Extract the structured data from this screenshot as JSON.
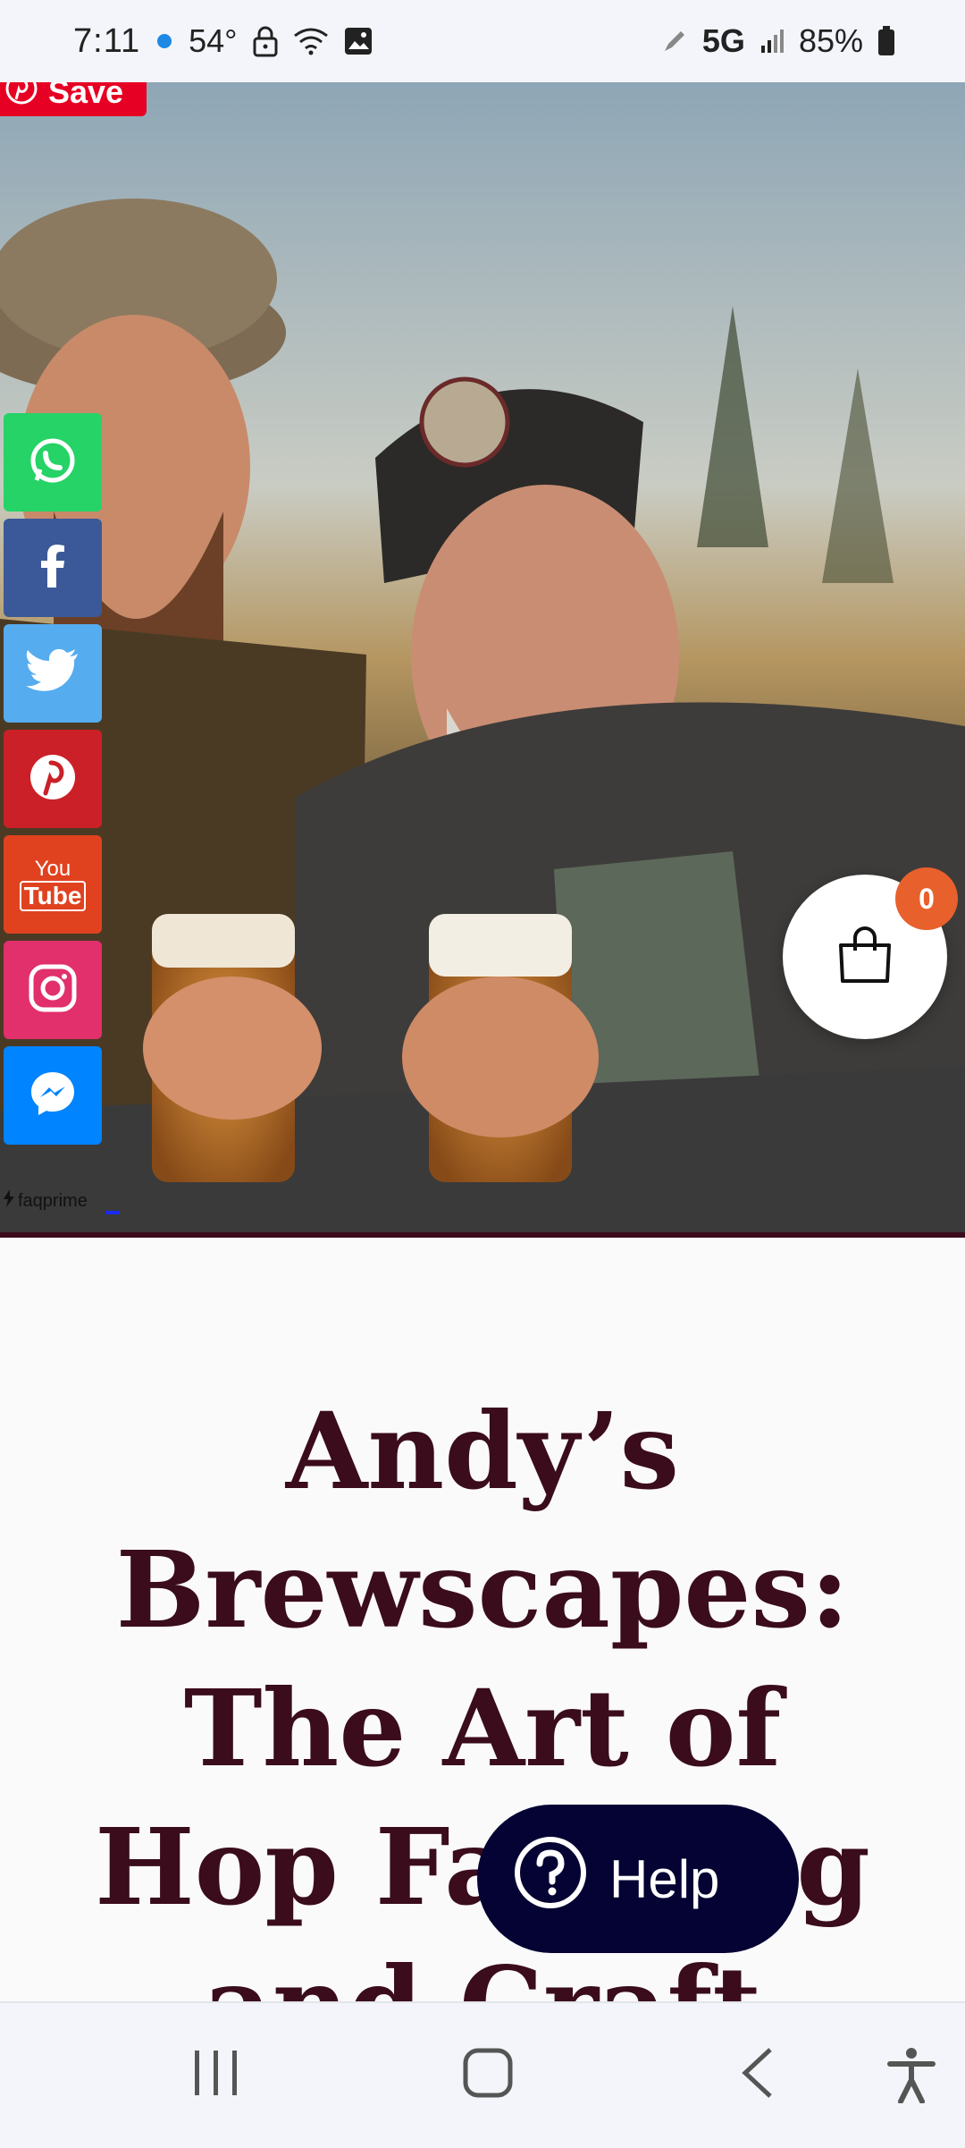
{
  "status_bar": {
    "time": "7:11",
    "temperature": "54°",
    "network": "5G",
    "battery": "85%"
  },
  "pinterest": {
    "save_label": "Save"
  },
  "social_buttons": [
    {
      "name": "whatsapp",
      "color": "#25d366"
    },
    {
      "name": "facebook",
      "color": "#3b5998"
    },
    {
      "name": "twitter",
      "color": "#55acee"
    },
    {
      "name": "pinterest",
      "color": "#cb2027"
    },
    {
      "name": "youtube",
      "color": "#e52d27",
      "text_top": "You",
      "text_bottom": "Tube"
    },
    {
      "name": "instagram",
      "color": "#e1306c"
    },
    {
      "name": "messenger",
      "color": "#0084ff"
    }
  ],
  "widget_credit": "faqprime",
  "cart": {
    "count": "0"
  },
  "article": {
    "title_lines": [
      "Andy’s",
      "Brewscapes:",
      "The Art of",
      "Hop Farming",
      "and Craft"
    ]
  },
  "help": {
    "label": "Help"
  },
  "colors": {
    "title": "#3a0c1c",
    "help_bg": "#040333",
    "cart_badge": "#e8602c",
    "pinterest_red": "#e60023"
  }
}
